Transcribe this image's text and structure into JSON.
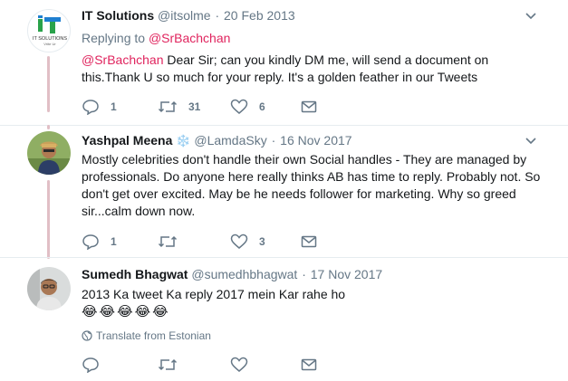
{
  "tweets": [
    {
      "name": "IT Solutions",
      "handle": "@itsolme",
      "dot": "·",
      "date": "20 Feb 2013",
      "replying_prefix": "Replying to",
      "replying_to": "@SrBachchan",
      "mention": "@SrBachchan",
      "text": " Dear Sir; can you kindly DM me, will send a document on this.Thank U so much for your reply. It's a golden feather in our Tweets",
      "avatar_label": "IT SOLUTIONS",
      "avatar_sub": "Vrite Ur",
      "reply_count": "1",
      "retweet_count": "31",
      "like_count": "6"
    },
    {
      "name": "Yashpal Meena",
      "badge": "❄️",
      "handle": "@LamdaSky",
      "dot": "·",
      "date": "16 Nov 2017",
      "text": "Mostly celebrities don't handle their own Social handles - They are managed by professionals. Do anyone here really thinks AB has time to reply. Probably not. So don't get over excited. May be he needs follower for marketing. Why so greed sir...calm down now.",
      "reply_count": "1",
      "retweet_count": "",
      "like_count": "3"
    },
    {
      "name": "Sumedh Bhagwat",
      "handle": "@sumedhbhagwat",
      "dot": "·",
      "date": "17 Nov 2017",
      "text": "2013 Ka tweet Ka reply 2017 mein Kar rahe ho",
      "emojis": [
        "😂",
        "😂",
        "😂",
        "😂",
        "😂"
      ],
      "translate": "Translate from Estonian",
      "reply_count": "",
      "retweet_count": "",
      "like_count": ""
    }
  ],
  "colors": {
    "text": "#14171a",
    "muted": "#657786",
    "link": "#e0245e",
    "thread": "#e1bfc6",
    "divider": "#e6ecf0"
  },
  "icons": [
    "reply-icon",
    "retweet-icon",
    "like-icon",
    "dm-icon",
    "chevron-down-icon",
    "globe-icon"
  ]
}
